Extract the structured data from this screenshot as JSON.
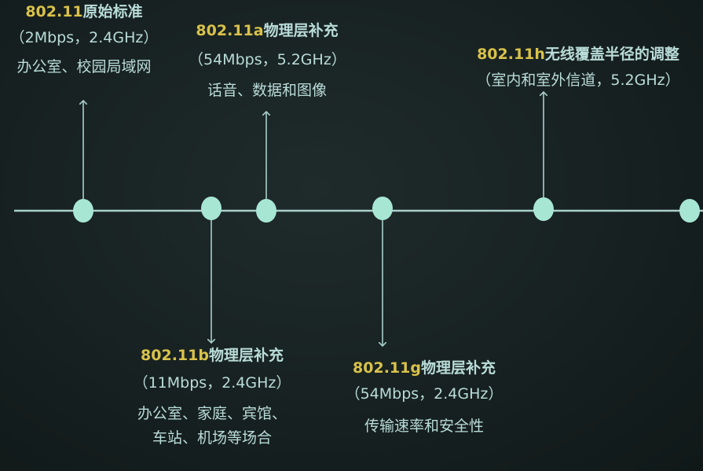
{
  "colors": {
    "background": "#172121",
    "timeline": "#a9cfcb",
    "node": "#a8e6d4",
    "standard_name": "#d9c24a",
    "text": "#b9dcd8"
  },
  "timeline": {
    "nodes": [
      {
        "id": "n1",
        "event": "802.11"
      },
      {
        "id": "n2",
        "event": "802.11b"
      },
      {
        "id": "n3",
        "event": "802.11a"
      },
      {
        "id": "n4",
        "event": "802.11g"
      },
      {
        "id": "n5",
        "event": "802.11h"
      },
      {
        "id": "n6",
        "event": ""
      }
    ]
  },
  "events": {
    "e80211": {
      "standard": "802.11",
      "title": "原始标准",
      "spec": "（2Mbps，2.4GHz）",
      "use_lines": [
        "办公室、校园局域网"
      ]
    },
    "e80211a": {
      "standard": "802.11a",
      "title": "物理层补充",
      "spec": "（54Mbps，5.2GHz）",
      "use_lines": [
        "话音、数据和图像"
      ]
    },
    "e80211h": {
      "standard": "802.11h",
      "title": "无线覆盖半径的调整",
      "spec": "（室内和室外信道，5.2GHz）",
      "use_lines": []
    },
    "e80211b": {
      "standard": "802.11b",
      "title": "物理层补充",
      "spec": "（11Mbps，2.4GHz）",
      "use_lines": [
        "办公室、家庭、宾馆、",
        "车站、机场等场合"
      ]
    },
    "e80211g": {
      "standard": "802.11g",
      "title": "物理层补充",
      "spec": "（54Mbps，2.4GHz）",
      "use_lines": [
        "传输速率和安全性"
      ]
    }
  }
}
